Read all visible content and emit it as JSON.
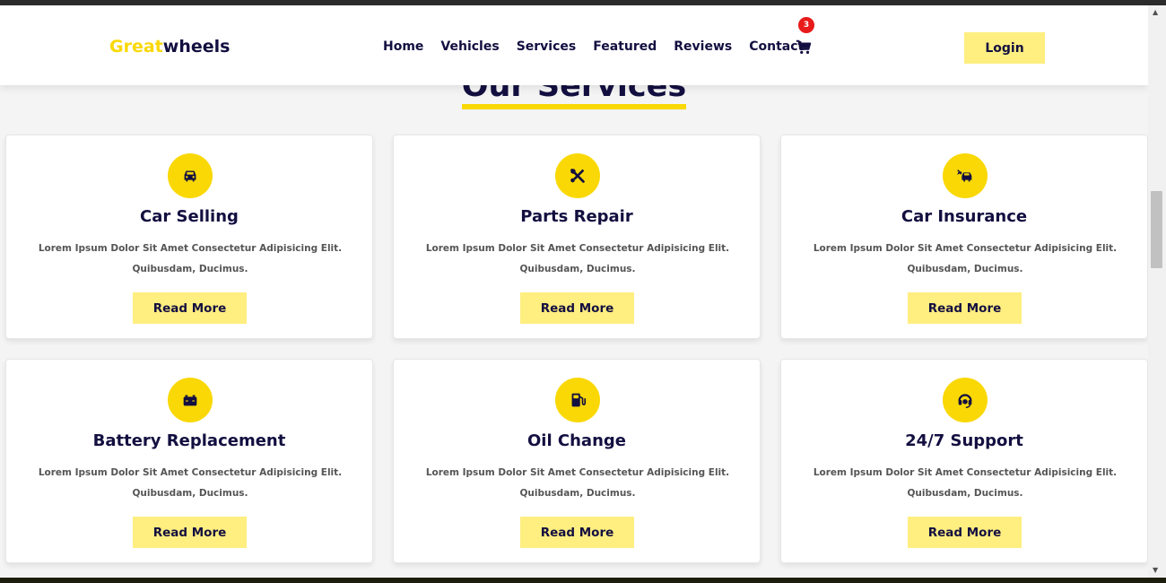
{
  "header": {
    "logo_accent": "Great",
    "logo_rest": "wheels",
    "nav": [
      "Home",
      "Vehicles",
      "Services",
      "Featured",
      "Reviews",
      "Contact"
    ],
    "cart_count": "3",
    "login_label": "Login"
  },
  "section": {
    "heading": "Our Services"
  },
  "services": [
    {
      "title": "Car Selling",
      "desc_line1": "Lorem Ipsum Dolor Sit Amet Consectetur Adipisicing Elit.",
      "desc_line2": "Quibusdam, Ducimus.",
      "button": "Read More",
      "icon": "car-icon"
    },
    {
      "title": "Parts Repair",
      "desc_line1": "Lorem Ipsum Dolor Sit Amet Consectetur Adipisicing Elit.",
      "desc_line2": "Quibusdam, Ducimus.",
      "button": "Read More",
      "icon": "tools-icon"
    },
    {
      "title": "Car Insurance",
      "desc_line1": "Lorem Ipsum Dolor Sit Amet Consectetur Adipisicing Elit.",
      "desc_line2": "Quibusdam, Ducimus.",
      "button": "Read More",
      "icon": "car-crash-icon"
    },
    {
      "title": "Battery Replacement",
      "desc_line1": "Lorem Ipsum Dolor Sit Amet Consectetur Adipisicing Elit.",
      "desc_line2": "Quibusdam, Ducimus.",
      "button": "Read More",
      "icon": "battery-icon"
    },
    {
      "title": "Oil Change",
      "desc_line1": "Lorem Ipsum Dolor Sit Amet Consectetur Adipisicing Elit.",
      "desc_line2": "Quibusdam, Ducimus.",
      "button": "Read More",
      "icon": "gas-pump-icon"
    },
    {
      "title": "24/7 Support",
      "desc_line1": "Lorem Ipsum Dolor Sit Amet Consectetur Adipisicing Elit.",
      "desc_line2": "Quibusdam, Ducimus.",
      "button": "Read More",
      "icon": "headset-icon"
    }
  ],
  "colors": {
    "accent": "#f9d806",
    "button_bg": "#ffee80",
    "text_dark": "#130f40",
    "badge": "#e81a1a"
  }
}
